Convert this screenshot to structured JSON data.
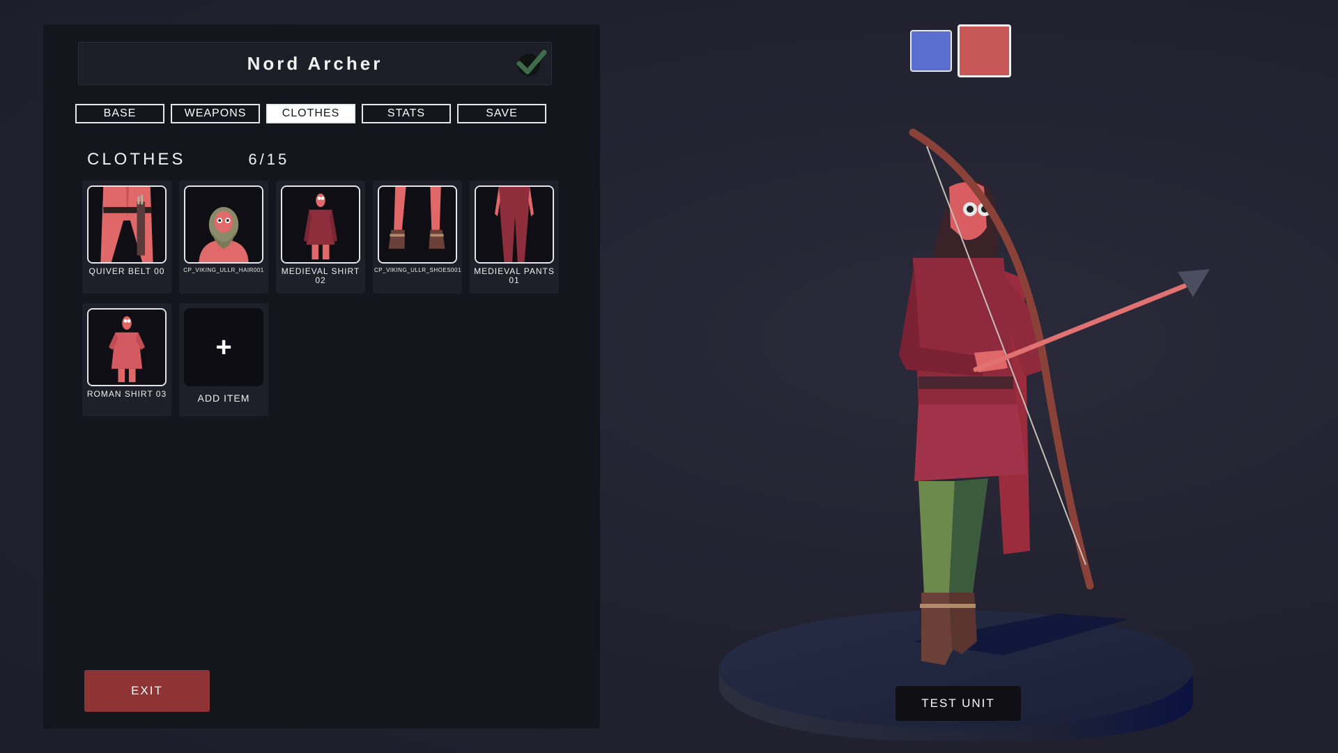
{
  "unit": {
    "name": "Nord Archer"
  },
  "tabs": [
    {
      "label": "BASE",
      "active": false
    },
    {
      "label": "WEAPONS",
      "active": false
    },
    {
      "label": "CLOTHES",
      "active": true
    },
    {
      "label": "STATS",
      "active": false
    },
    {
      "label": "SAVE",
      "active": false
    }
  ],
  "clothes": {
    "title": "CLOTHES",
    "count": "6/15",
    "items": [
      {
        "label": "QUIVER BELT 00"
      },
      {
        "label": "CP_VIKING_ULLR_HAIR001"
      },
      {
        "label": "MEDIEVAL SHIRT 02"
      },
      {
        "label": "CP_VIKING_ULLR_SHOES001"
      },
      {
        "label": "MEDIEVAL PANTS 01"
      },
      {
        "label": "ROMAN SHIRT 03"
      }
    ],
    "add_item": {
      "symbol": "+",
      "label": "ADD ITEM"
    }
  },
  "buttons": {
    "exit": "EXIT",
    "test_unit": "TEST UNIT"
  },
  "team_colors": {
    "blue": "#5b6fd0",
    "red": "#c85858"
  },
  "icons": {
    "confirm": "check-icon"
  }
}
